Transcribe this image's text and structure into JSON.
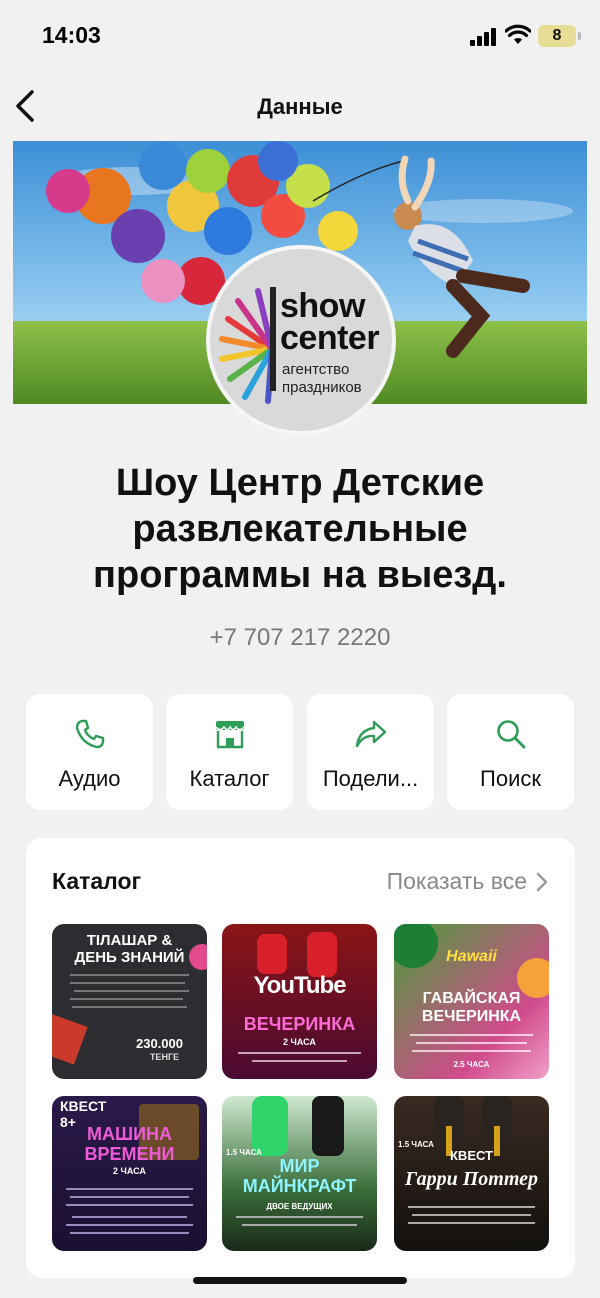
{
  "status": {
    "time": "14:03",
    "battery": "8"
  },
  "nav": {
    "title": "Данные"
  },
  "cover": {
    "logo_line1": "show",
    "logo_line2": "center",
    "logo_line3": "агентство",
    "logo_line4": "праздников"
  },
  "business": {
    "name_line1": "Шоу Центр Детские",
    "name_line2": "развлекательные",
    "name_line3": "программы на выезд.",
    "phone": "+7 707 217 2220"
  },
  "actions": [
    {
      "label": "Аудио",
      "icon": "phone-icon"
    },
    {
      "label": "Каталог",
      "icon": "store-icon"
    },
    {
      "label": "Подели...",
      "icon": "share-icon"
    },
    {
      "label": "Поиск",
      "icon": "search-icon"
    }
  ],
  "catalog": {
    "title": "Каталог",
    "show_all": "Показать все",
    "items": [
      {
        "title": "ТІЛАШАР & ДЕНЬ ЗНАНИЙ",
        "price": "230.000",
        "currency": "ТЕНГЕ"
      },
      {
        "brand": "YouTube",
        "title": "ВЕЧЕРИНКА",
        "duration": "2 ЧАСА"
      },
      {
        "brand": "Hawaii",
        "title": "ГАВАЙСКАЯ ВЕЧЕРИНКА",
        "duration": "2.5 ЧАСА"
      },
      {
        "badge": "КВЕСТ 8+",
        "title": "МАШИНА ВРЕМЕНИ",
        "duration": "2 ЧАСА"
      },
      {
        "title": "МИР МАЙНКРАФТ",
        "duration": "1.5 ЧАСА",
        "sub": "ДВОЕ ВЕДУЩИХ"
      },
      {
        "badge": "КВЕСТ",
        "title": "Гарри Поттер",
        "duration": "1.5 ЧАСА"
      }
    ]
  },
  "colors": {
    "accent": "#2e9d57",
    "background": "#f1f1f2",
    "card": "#ffffff"
  }
}
